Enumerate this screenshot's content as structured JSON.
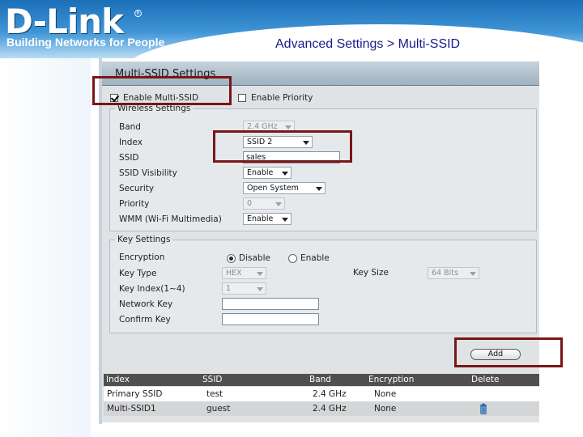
{
  "banner": {
    "logo": "D-Link",
    "registered": "R",
    "tagline": "Building Networks for People",
    "page_heading": "Advanced Settings > Multi-SSID"
  },
  "panel": {
    "title": "Multi-SSID Settings",
    "enable_multi_ssid": {
      "label": "Enable Multi-SSID",
      "checked": true
    },
    "enable_priority": {
      "label": "Enable Priority",
      "checked": false
    }
  },
  "wireless": {
    "legend": "Wireless Settings",
    "band_label": "Band",
    "band_value": "2.4 GHz",
    "index_label": "Index",
    "index_value": "SSID 2",
    "ssid_label": "SSID",
    "ssid_value": "sales",
    "visibility_label": "SSID Visibility",
    "visibility_value": "Enable",
    "security_label": "Security",
    "security_value": "Open System",
    "priority_label": "Priority",
    "priority_value": "0",
    "wmm_label": "WMM (Wi-Fi Multimedia)",
    "wmm_value": "Enable"
  },
  "key": {
    "legend": "Key Settings",
    "encryption_label": "Encryption",
    "disable_label": "Disable",
    "enable_label": "Enable",
    "selected": "Disable",
    "type_label": "Key Type",
    "type_value": "HEX",
    "size_label": "Key Size",
    "size_value": "64 Bits",
    "index_label": "Key Index(1~4)",
    "index_value": "1",
    "network_key_label": "Network Key",
    "network_key_value": "",
    "confirm_key_label": "Confirm Key",
    "confirm_key_value": ""
  },
  "add_label": "Add",
  "table": {
    "headers": [
      "Index",
      "SSID",
      "Band",
      "Encryption",
      "Delete"
    ],
    "rows": [
      {
        "index": "Primary SSID",
        "ssid": "test",
        "band": "2.4 GHz",
        "encryption": "None"
      },
      {
        "index": "Multi-SSID1",
        "ssid": "guest",
        "band": "2.4 GHz",
        "encryption": "None"
      }
    ]
  },
  "colors": {
    "highlight": "#7a1616",
    "banner_blue": "#1b6fb8",
    "heading": "#1a1a8c",
    "table_header": "#505050"
  },
  "icons": {
    "delete": "trash-can-icon",
    "dropdown": "chevron-down-icon",
    "checkbox": "checkmark-icon"
  }
}
